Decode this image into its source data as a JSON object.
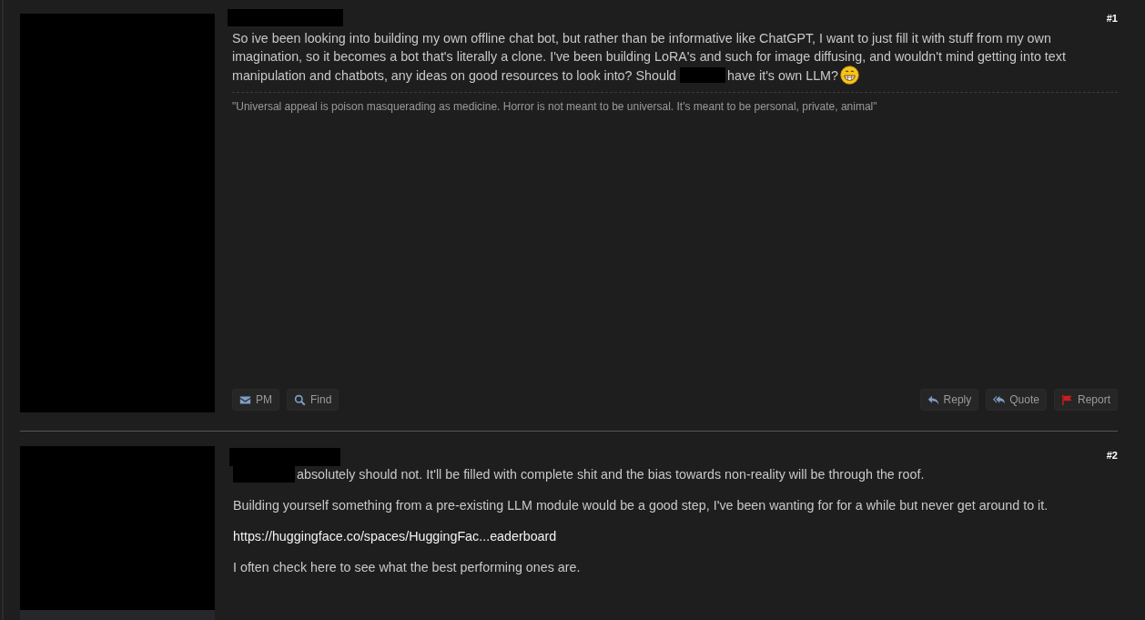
{
  "posts": [
    {
      "number": "#1",
      "paragraphs": [
        {
          "kind": "paragraph",
          "lines": [
            [
              {
                "kind": "text",
                "text": "So ive been looking into building my own offline chat bot, but rather than be informative like ChatGPT, I want to just fill it with stuff from my own"
              }
            ],
            [
              {
                "kind": "text",
                "text": "imagination, so it becomes a bot that's literally a clone. I've been building LoRA's and such for image diffusing, and wouldn't mind getting into text"
              }
            ],
            [
              {
                "kind": "text",
                "text": "manipulation and chatbots, any ideas on good resources to look into? Should"
              },
              {
                "kind": "redaction"
              },
              {
                "kind": "text",
                "text": "have it's own LLM?"
              },
              {
                "kind": "emoji"
              }
            ]
          ]
        }
      ],
      "signature": "\"Universal appeal is poison masquerading as medicine. Horror is not meant to be universal. It's meant to be personal, private, animal\"",
      "actions_left": [
        {
          "label": "PM",
          "kind": "envelope"
        },
        {
          "label": "Find",
          "kind": "search"
        }
      ],
      "actions_right": [
        {
          "label": "Reply",
          "kind": "reply"
        },
        {
          "label": "Quote",
          "kind": "reply-all"
        },
        {
          "label": "Report",
          "kind": "flag"
        }
      ]
    },
    {
      "number": "#2",
      "paragraphs": [
        {
          "kind": "paragraph",
          "lines": [
            [
              {
                "kind": "redaction"
              },
              {
                "kind": "text",
                "text": "absolutely should not. It'll be filled with complete shit and the bias towards non-reality will be through the roof."
              }
            ]
          ]
        },
        {
          "kind": "paragraph",
          "lines": [
            [
              {
                "kind": "text",
                "text": "Building yourself something from a pre-existing LLM module would be a good step, I've been wanting for for a while but never get around to it."
              }
            ]
          ]
        },
        {
          "kind": "link",
          "lines": [
            [
              {
                "kind": "text",
                "text": "https://huggingface.co/spaces/HuggingFac...eaderboard"
              }
            ]
          ]
        },
        {
          "kind": "paragraph",
          "lines": [
            [
              {
                "kind": "text",
                "text": "I often check here to see what the best performing ones are."
              }
            ]
          ]
        }
      ]
    }
  ]
}
